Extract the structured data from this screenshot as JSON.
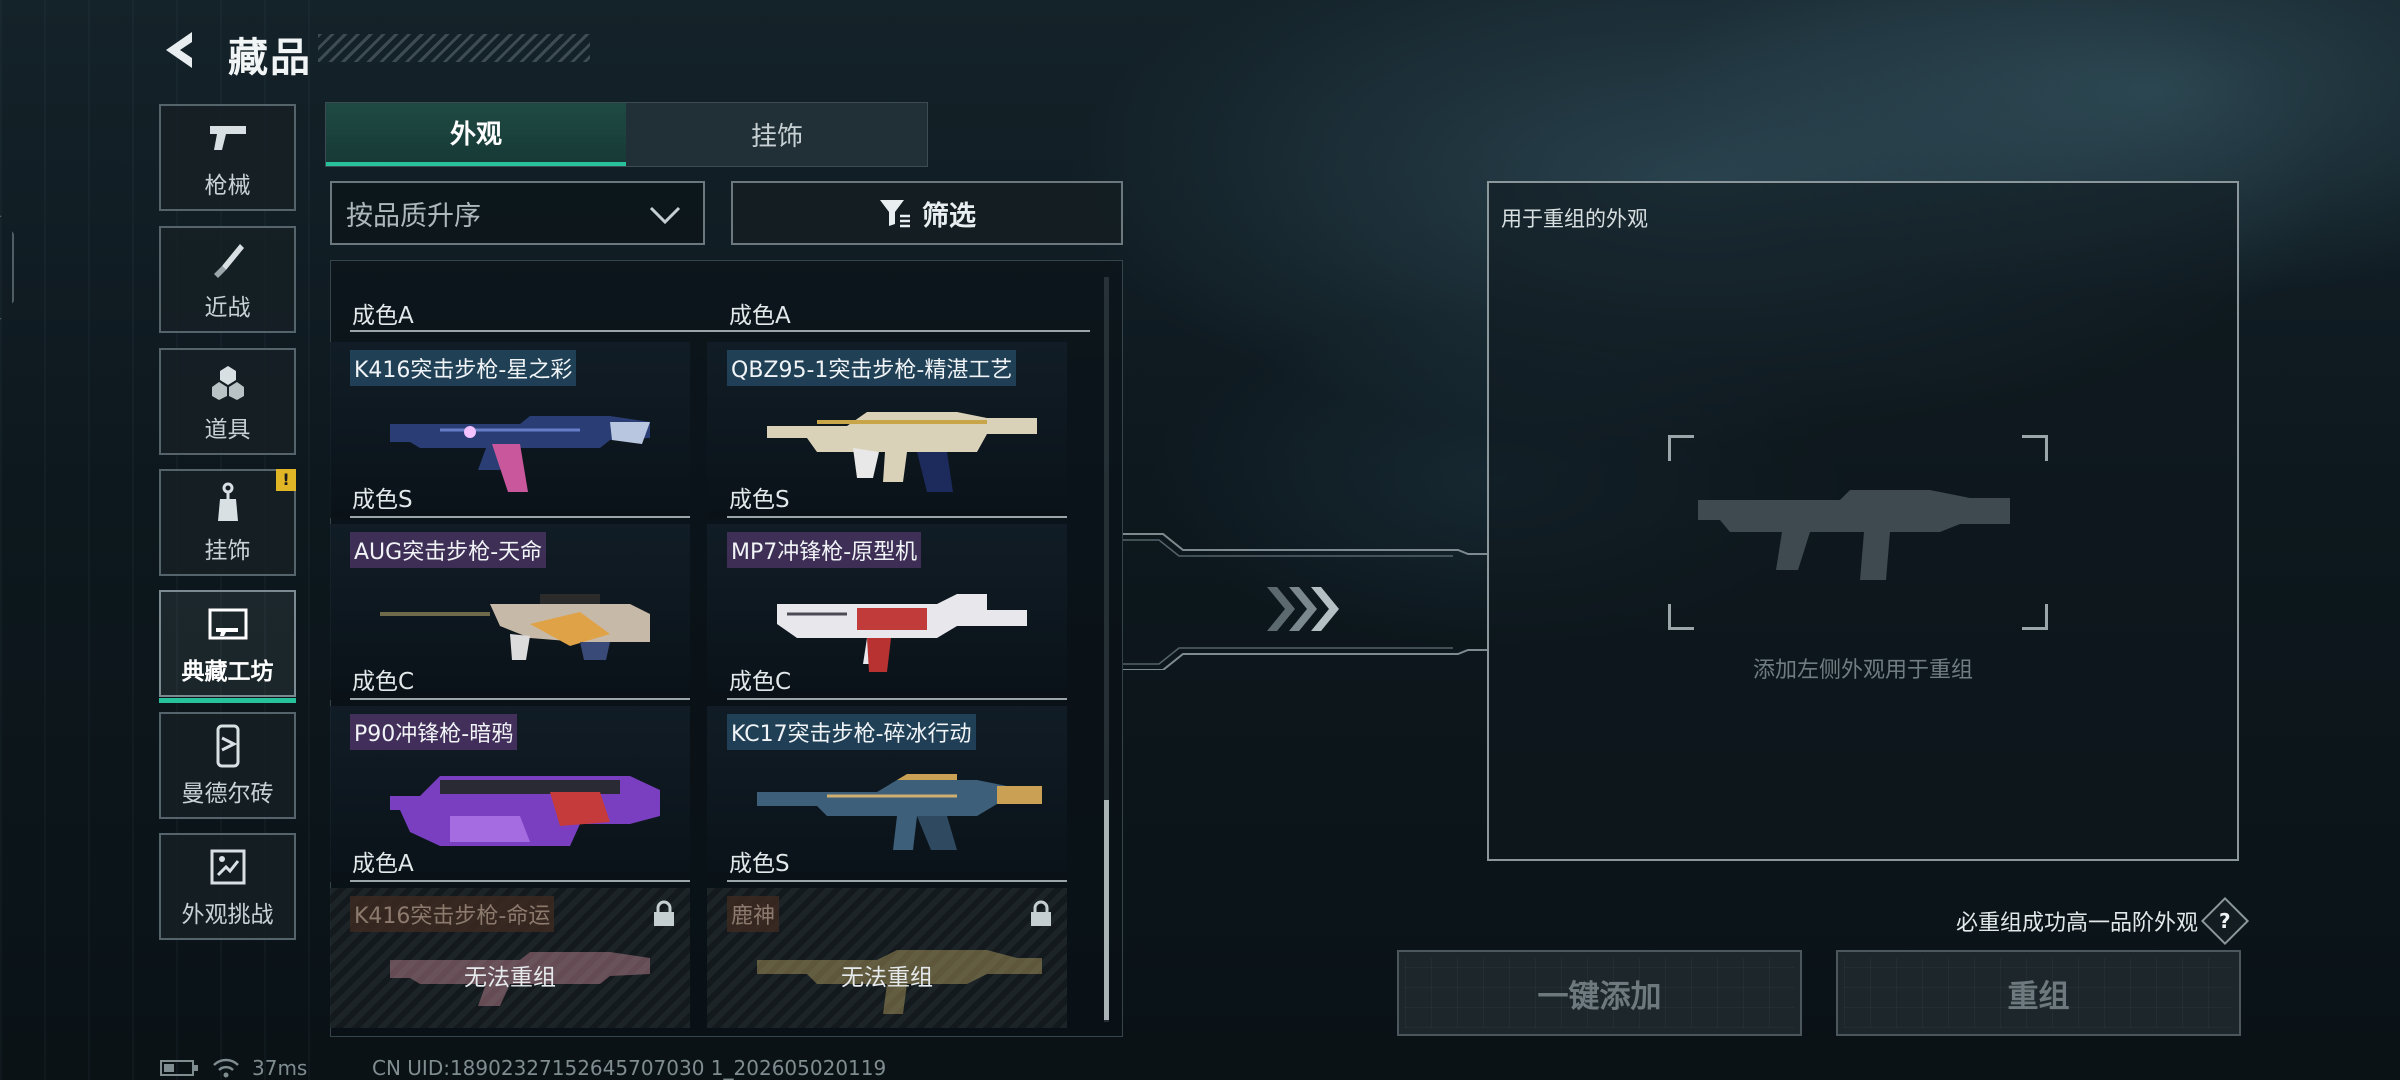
{
  "header": {
    "title": "藏品"
  },
  "sidebar": {
    "items": [
      {
        "label": "枪械",
        "icon": "pistol-icon"
      },
      {
        "label": "近战",
        "icon": "knife-icon"
      },
      {
        "label": "道具",
        "icon": "grenade-icon"
      },
      {
        "label": "挂饰",
        "icon": "charm-icon",
        "badge": "!"
      },
      {
        "label": "典藏工坊",
        "icon": "workshop-icon",
        "active": true
      },
      {
        "label": "曼德尔砖",
        "icon": "brick-icon"
      },
      {
        "label": "外观挑战",
        "icon": "challenge-icon"
      }
    ]
  },
  "tabs": [
    {
      "label": "外观",
      "active": true
    },
    {
      "label": "挂饰",
      "active": false
    }
  ],
  "sort": {
    "value": "按品质升序"
  },
  "filter": {
    "label": "筛选"
  },
  "list": {
    "top_partial": [
      "成色A",
      "成色A"
    ],
    "cards": [
      {
        "name": "K416突击步枪-星之彩",
        "grade": "成色S",
        "rarity": "s"
      },
      {
        "name": "QBZ95-1突击步枪-精湛工艺",
        "grade": "成色S",
        "rarity": "s"
      },
      {
        "name": "AUG突击步枪-天命",
        "grade": "成色C",
        "rarity": "c"
      },
      {
        "name": "MP7冲锋枪-原型机",
        "grade": "成色C",
        "rarity": "c"
      },
      {
        "name": "P90冲锋枪-暗鸦",
        "grade": "成色A",
        "rarity": "a"
      },
      {
        "name": "KC17突击步枪-碎冰行动",
        "grade": "成色S",
        "rarity": "s"
      },
      {
        "name": "K416突击步枪-命运",
        "status": "无法重组",
        "locked": true
      },
      {
        "name": "鹿神",
        "status": "无法重组",
        "locked": true
      }
    ]
  },
  "recombine": {
    "title": "用于重组的外观",
    "placeholder": "添加左侧外观用于重组",
    "guarantee": "必重组成功高一品阶外观",
    "help": "?",
    "add_all_label": "一键添加",
    "recombine_label": "重组"
  },
  "status_bar": {
    "ping": "37ms",
    "uid": "CN UID:18902327152645707030 1_202605020119"
  },
  "colors": {
    "accent": "#27c29b",
    "warning": "#e0b627"
  }
}
